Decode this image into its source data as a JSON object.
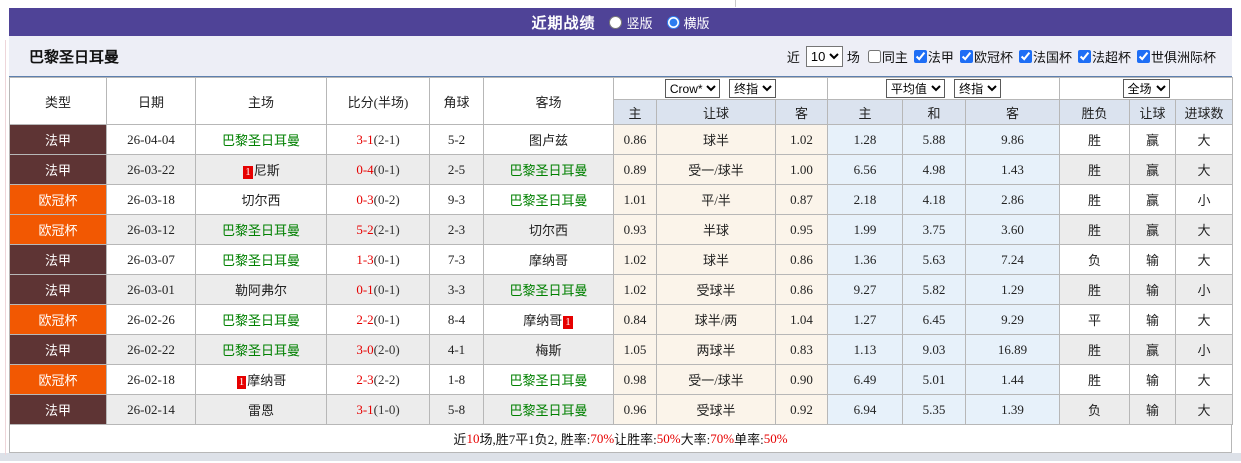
{
  "title_bar": {
    "title": "近期战绩",
    "radio_vertical": "竖版",
    "radio_horizontal": "横版",
    "selected": "横版"
  },
  "toolbar": {
    "team_name": "巴黎圣日耳曼",
    "near_label": "近",
    "matches_count": "10",
    "matches_unit": "场",
    "same_home_label": "同主",
    "same_home_checked": false,
    "filters": [
      "法甲",
      "欧冠杯",
      "法国杯",
      "法超杯",
      "世俱洲际杯"
    ],
    "filters_checked": [
      true,
      true,
      true,
      true,
      true
    ]
  },
  "colors": {
    "accent_purple": "#4f4397",
    "league_ligue1_bg": "#5e3434",
    "league_ucl_bg": "#f25802",
    "team_highlight_green": "#008000",
    "win_red": "#e60000",
    "lose_blue": "#0010d0",
    "draw_green": "#009933",
    "handicap_group_bg": "#fbf4ea",
    "average_group_bg": "#e7f1fa",
    "header_bg": "#dbe3ef"
  },
  "table": {
    "columns": [
      "类型",
      "日期",
      "主场",
      "比分(半场)",
      "角球",
      "客场"
    ],
    "dropdowns": {
      "bookmaker": "Crow*",
      "stage1": "终指",
      "average": "平均值",
      "stage2": "终指",
      "scope": "全场"
    },
    "subheaders": [
      "主",
      "让球",
      "客",
      "主",
      "和",
      "客",
      "胜负",
      "让球",
      "进球数"
    ],
    "rows": [
      {
        "type": "法甲",
        "type_class": "t-fa",
        "date": "26-04-04",
        "home": "巴黎圣日耳曼",
        "home_green": true,
        "home_badge": "",
        "home_badge_pos": "",
        "score": "3-1",
        "half": "(2-1)",
        "corners": "5-2",
        "away": "图卢兹",
        "away_green": false,
        "away_badge": "",
        "away_badge_pos": "",
        "odds": [
          "0.86",
          "球半",
          "1.02"
        ],
        "avg": [
          "1.28",
          "5.88",
          "9.86"
        ],
        "results": [
          {
            "t": "胜",
            "c": "r"
          },
          {
            "t": "赢",
            "c": "r"
          },
          {
            "t": "大",
            "c": "r"
          }
        ]
      },
      {
        "type": "法甲",
        "type_class": "t-fa",
        "date": "26-03-22",
        "home": "尼斯",
        "home_green": false,
        "home_badge": "1",
        "home_badge_pos": "before",
        "score": "0-4",
        "half": "(0-1)",
        "corners": "2-5",
        "away": "巴黎圣日耳曼",
        "away_green": true,
        "away_badge": "",
        "away_badge_pos": "",
        "odds": [
          "0.89",
          "受一/球半",
          "1.00"
        ],
        "avg": [
          "6.56",
          "4.98",
          "1.43"
        ],
        "results": [
          {
            "t": "胜",
            "c": "r"
          },
          {
            "t": "赢",
            "c": "r"
          },
          {
            "t": "大",
            "c": "r"
          }
        ]
      },
      {
        "type": "欧冠杯",
        "type_class": "t-ucl",
        "date": "26-03-18",
        "home": "切尔西",
        "home_green": false,
        "home_badge": "",
        "home_badge_pos": "",
        "score": "0-3",
        "half": "(0-2)",
        "corners": "9-3",
        "away": "巴黎圣日耳曼",
        "away_green": true,
        "away_badge": "",
        "away_badge_pos": "",
        "odds": [
          "1.01",
          "平/半",
          "0.87"
        ],
        "avg": [
          "2.18",
          "4.18",
          "2.86"
        ],
        "results": [
          {
            "t": "胜",
            "c": "r"
          },
          {
            "t": "赢",
            "c": "r"
          },
          {
            "t": "小",
            "c": "b"
          }
        ]
      },
      {
        "type": "欧冠杯",
        "type_class": "t-ucl",
        "date": "26-03-12",
        "home": "巴黎圣日耳曼",
        "home_green": true,
        "home_badge": "",
        "home_badge_pos": "",
        "score": "5-2",
        "half": "(2-1)",
        "corners": "2-3",
        "away": "切尔西",
        "away_green": false,
        "away_badge": "",
        "away_badge_pos": "",
        "odds": [
          "0.93",
          "半球",
          "0.95"
        ],
        "avg": [
          "1.99",
          "3.75",
          "3.60"
        ],
        "results": [
          {
            "t": "胜",
            "c": "r"
          },
          {
            "t": "赢",
            "c": "r"
          },
          {
            "t": "大",
            "c": "r"
          }
        ]
      },
      {
        "type": "法甲",
        "type_class": "t-fa",
        "date": "26-03-07",
        "home": "巴黎圣日耳曼",
        "home_green": true,
        "home_badge": "",
        "home_badge_pos": "",
        "score": "1-3",
        "half": "(0-1)",
        "corners": "7-3",
        "away": "摩纳哥",
        "away_green": false,
        "away_badge": "",
        "away_badge_pos": "",
        "odds": [
          "1.02",
          "球半",
          "0.86"
        ],
        "avg": [
          "1.36",
          "5.63",
          "7.24"
        ],
        "results": [
          {
            "t": "负",
            "c": "b"
          },
          {
            "t": "输",
            "c": "b"
          },
          {
            "t": "大",
            "c": "r"
          }
        ]
      },
      {
        "type": "法甲",
        "type_class": "t-fa",
        "date": "26-03-01",
        "home": "勒阿弗尔",
        "home_green": false,
        "home_badge": "",
        "home_badge_pos": "",
        "score": "0-1",
        "half": "(0-1)",
        "corners": "3-3",
        "away": "巴黎圣日耳曼",
        "away_green": true,
        "away_badge": "",
        "away_badge_pos": "",
        "odds": [
          "1.02",
          "受球半",
          "0.86"
        ],
        "avg": [
          "9.27",
          "5.82",
          "1.29"
        ],
        "results": [
          {
            "t": "胜",
            "c": "r"
          },
          {
            "t": "输",
            "c": "b"
          },
          {
            "t": "小",
            "c": "b"
          }
        ]
      },
      {
        "type": "欧冠杯",
        "type_class": "t-ucl",
        "date": "26-02-26",
        "home": "巴黎圣日耳曼",
        "home_green": true,
        "home_badge": "",
        "home_badge_pos": "",
        "score": "2-2",
        "half": "(0-1)",
        "corners": "8-4",
        "away": "摩纳哥",
        "away_green": false,
        "away_badge": "1",
        "away_badge_pos": "after",
        "odds": [
          "0.84",
          "球半/两",
          "1.04"
        ],
        "avg": [
          "1.27",
          "6.45",
          "9.29"
        ],
        "results": [
          {
            "t": "平",
            "c": "g"
          },
          {
            "t": "输",
            "c": "b"
          },
          {
            "t": "大",
            "c": "r"
          }
        ]
      },
      {
        "type": "法甲",
        "type_class": "t-fa",
        "date": "26-02-22",
        "home": "巴黎圣日耳曼",
        "home_green": true,
        "home_badge": "",
        "home_badge_pos": "",
        "score": "3-0",
        "half": "(2-0)",
        "corners": "4-1",
        "away": "梅斯",
        "away_green": false,
        "away_badge": "",
        "away_badge_pos": "",
        "odds": [
          "1.05",
          "两球半",
          "0.83"
        ],
        "avg": [
          "1.13",
          "9.03",
          "16.89"
        ],
        "results": [
          {
            "t": "胜",
            "c": "r"
          },
          {
            "t": "赢",
            "c": "r"
          },
          {
            "t": "小",
            "c": "b"
          }
        ]
      },
      {
        "type": "欧冠杯",
        "type_class": "t-ucl",
        "date": "26-02-18",
        "home": "摩纳哥",
        "home_green": false,
        "home_badge": "1",
        "home_badge_pos": "before",
        "score": "2-3",
        "half": "(2-2)",
        "corners": "1-8",
        "away": "巴黎圣日耳曼",
        "away_green": true,
        "away_badge": "",
        "away_badge_pos": "",
        "odds": [
          "0.98",
          "受一/球半",
          "0.90"
        ],
        "avg": [
          "6.49",
          "5.01",
          "1.44"
        ],
        "results": [
          {
            "t": "胜",
            "c": "r"
          },
          {
            "t": "输",
            "c": "b"
          },
          {
            "t": "大",
            "c": "r"
          }
        ]
      },
      {
        "type": "法甲",
        "type_class": "t-fa",
        "date": "26-02-14",
        "home": "雷恩",
        "home_green": false,
        "home_badge": "",
        "home_badge_pos": "",
        "score": "3-1",
        "half": "(1-0)",
        "corners": "5-8",
        "away": "巴黎圣日耳曼",
        "away_green": true,
        "away_badge": "",
        "away_badge_pos": "",
        "odds": [
          "0.96",
          "受球半",
          "0.92"
        ],
        "avg": [
          "6.94",
          "5.35",
          "1.39"
        ],
        "results": [
          {
            "t": "负",
            "c": "b"
          },
          {
            "t": "输",
            "c": "b"
          },
          {
            "t": "大",
            "c": "r"
          }
        ]
      }
    ]
  },
  "footer": {
    "segments": [
      {
        "t": "近",
        "c": "k"
      },
      {
        "t": "10",
        "c": "r"
      },
      {
        "t": "场,胜7平1负2, 胜率:",
        "c": "k"
      },
      {
        "t": "70%",
        "c": "r"
      },
      {
        "t": " 让胜率:",
        "c": "k"
      },
      {
        "t": "50%",
        "c": "r"
      },
      {
        "t": " 大率:",
        "c": "k"
      },
      {
        "t": "70%",
        "c": "r"
      },
      {
        "t": " 单率:",
        "c": "k"
      },
      {
        "t": "50%",
        "c": "r"
      }
    ]
  }
}
